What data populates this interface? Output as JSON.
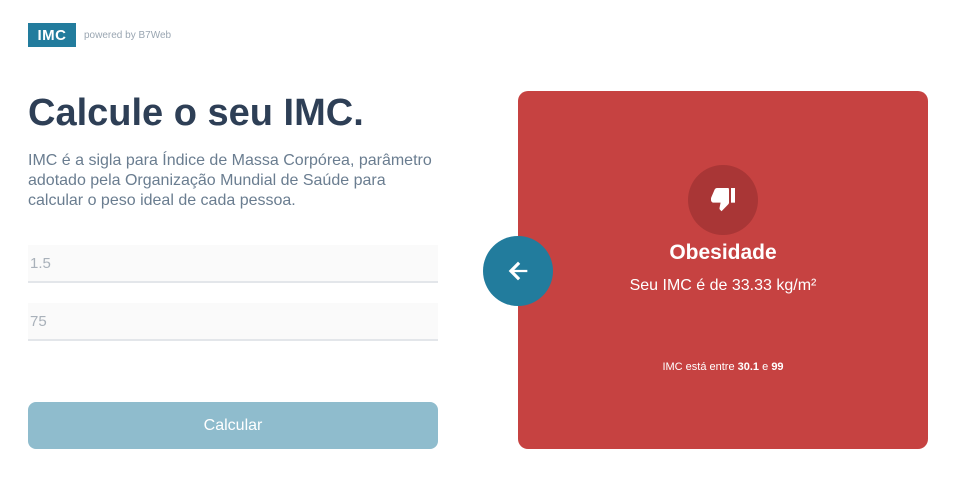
{
  "header": {
    "logo_text": "IMC",
    "powered_by": "powered by B7Web"
  },
  "left": {
    "title": "Calcule o seu IMC.",
    "description": "IMC é a sigla para Índice de Massa Corpórea, parâmetro adotado pela Organização Mundial de Saúde para calcular o peso ideal de cada pessoa.",
    "height_value": "1.5",
    "weight_value": "75",
    "calculate_label": "Calcular"
  },
  "result": {
    "icon": "thumbs-down-icon",
    "title": "Obesidade",
    "text": "Seu IMC é de 33.33 kg/m²",
    "range_prefix": "IMC está entre",
    "range_min": "30.1",
    "range_joiner": "e",
    "range_max": "99"
  },
  "colors": {
    "brand": "#227c9d",
    "result_bg": "#c64241",
    "button_disabled": "#8fbccd"
  }
}
